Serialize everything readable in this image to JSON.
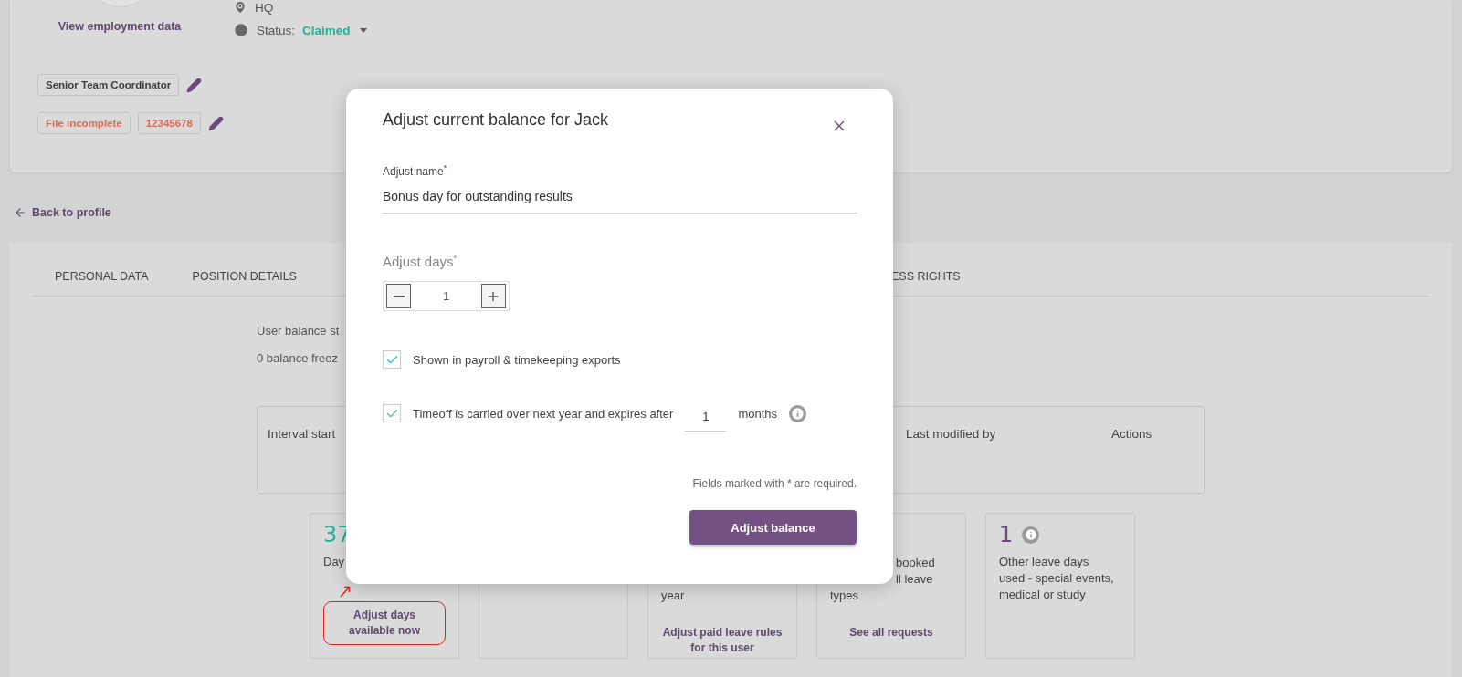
{
  "profile": {
    "location": "HQ",
    "view_link": "View employment data",
    "status_label": "Status:",
    "status_value": "Claimed",
    "position_tag": "Senior Team Coordinator",
    "file_tags": [
      {
        "label": "File incomplete"
      },
      {
        "label": "12345678"
      }
    ]
  },
  "back_link": "Back to profile",
  "tabs": [
    {
      "label": "PERSONAL DATA",
      "selected": false
    },
    {
      "label": "POSITION DETAILS",
      "selected": false
    },
    {
      "label": "ESS RIGHTS",
      "selected": false
    }
  ],
  "balance_info": [
    "User balance st",
    "0 balance freez"
  ],
  "table": {
    "columns": [
      "Interval start",
      "Last modified by",
      "Actions"
    ]
  },
  "stat_cards": [
    {
      "kind": "stat",
      "value": "37",
      "color": "#27b093",
      "lines": [
        {
          "text": "Day",
          "clipped": false
        }
      ],
      "link": "Adjust days available now",
      "highlighted": true
    },
    {
      "kind": "empty"
    },
    {
      "kind": "stat",
      "lines": [
        {
          "text": "year",
          "clipped": false
        }
      ],
      "link": "Adjust paid leave rules for this user",
      "highlighted": false
    },
    {
      "kind": "stat",
      "lines": [
        {
          "text": "booked",
          "clipped": true
        },
        {
          "text": "ll leave",
          "clipped": true
        },
        {
          "text": "types",
          "clipped": false
        }
      ],
      "link": "See all requests",
      "highlighted": false
    },
    {
      "kind": "stat",
      "value": "1",
      "color": "#6a4c7c",
      "info": true,
      "lines": [
        {
          "text": "Other leave days",
          "clipped": false
        },
        {
          "text": "used - special events,",
          "clipped": false
        },
        {
          "text": "medical or study",
          "clipped": false
        }
      ],
      "highlighted": false
    }
  ],
  "modal": {
    "title": "Adjust current balance for Jack",
    "name_field": {
      "label": "Adjust name$^{*}$",
      "value": "Bonus day for outstanding results"
    },
    "days_field": {
      "label": "Adjust days$^{*}$",
      "value": "1"
    },
    "options": [
      {
        "kind": "plain",
        "label": "Shown in payroll & timekeeping exports",
        "checked": true
      },
      {
        "kind": "months",
        "label": "Timeoff is carried over next year and expires after",
        "value": "1",
        "suffix": "months",
        "checked": true
      }
    ],
    "note": "Fields marked with * are required.",
    "submit": "Adjust balance"
  }
}
